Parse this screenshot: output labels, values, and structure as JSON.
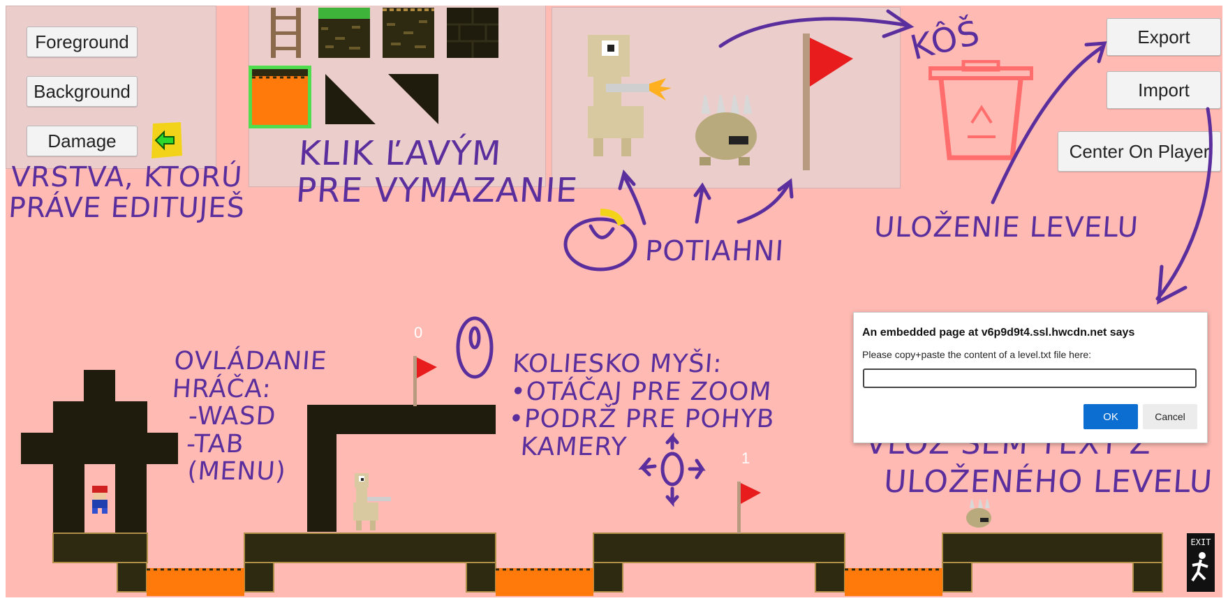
{
  "layer_buttons": {
    "foreground": "Foreground",
    "background": "Background",
    "damage": "Damage"
  },
  "top_right_buttons": {
    "export": "Export",
    "import": "Import",
    "center_on_player": "Center On Player"
  },
  "annotations": {
    "layer_note_line1": "VRSTVA, KTORÚ",
    "layer_note_line2": "PRÁVE EDITUJEŠ",
    "erase_note_line1": "KLIK ĽAVÝM",
    "erase_note_line2": "PRE VYMAZANIE",
    "trash_label": "KÔŠ",
    "drag_note": "POTIAHNI",
    "save_note": "ULOŽENIE LEVELU",
    "controls_title_line1": "OVLÁDANIE",
    "controls_title_line2": "HRÁČA:",
    "controls_wasd": "-WASD",
    "controls_tab": "-TAB",
    "controls_menu": "(MENU)",
    "wheel_title": "KOLIESKO MYŠI:",
    "wheel_zoom": "•OTÁČAJ PRE ZOOM",
    "wheel_move": "•PODRŽ PRE POHYB",
    "wheel_camera": "KAMERY",
    "paste_note_line1": "VLOŽ SEM TEXT Z",
    "paste_note_line2": "ULOŽENÉHO LEVELU"
  },
  "dialog": {
    "title": "An embedded page at v6p9d9t4.ssl.hwcdn.net says",
    "message": "Please copy+paste the content of a level.txt file here:",
    "input_value": "",
    "ok_label": "OK",
    "cancel_label": "Cancel"
  },
  "checkpoints": {
    "flag_0": "0",
    "flag_1": "1"
  },
  "exit_sign": "EXIT",
  "colors": {
    "background": "#ffbbb3",
    "annotation_ink": "#5a2e9c",
    "selection_outline": "#4fdc4f",
    "highlight_yellow": "#f3d21a",
    "lava": "#ff7a0a",
    "ground_dark": "#2e2a12",
    "dialog_ok": "#0b6ed0",
    "trash_icon": "#ff6d6d"
  },
  "palette": {
    "tiles": [
      "ladder-tile",
      "grass-dirt-tile",
      "dirt-tile",
      "dark-brick-tile",
      "lava-tile",
      "slope-left-tile",
      "slope-right-tile"
    ],
    "entities": [
      "llama-gunner-sprite",
      "spiked-beetle-sprite",
      "checkpoint-flag-sprite"
    ]
  }
}
